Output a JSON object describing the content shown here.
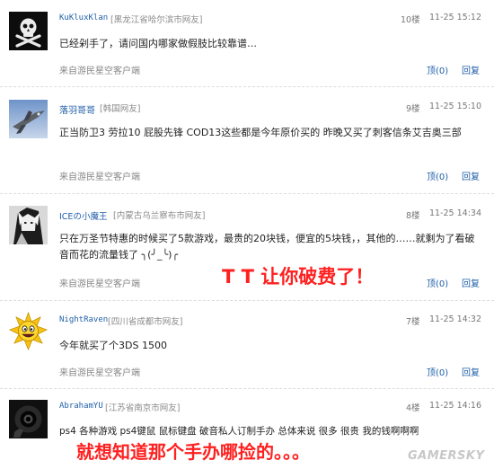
{
  "comments": [
    {
      "user": "KuKluxKlan",
      "location": "[黑龙江省哈尔滨市网友]",
      "floor": "10楼",
      "time": "11-25 15:12",
      "text": "已经剁手了，请问国内哪家做假肢比较靠谱…",
      "source": "来自游民星空客户端",
      "upvote_label": "顶",
      "upvote_count": "(0)",
      "reply_label": "回复",
      "avatar_icon": "skull-crossbones-icon"
    },
    {
      "user": "落羽哥哥",
      "location": "[韩国网友]",
      "floor": "9楼",
      "time": "11-25 15:10",
      "text": "正当防卫3 劳拉10 屁股先锋 COD13这些都是今年原价买的    昨晚又买了刺客信条艾吉奥三部",
      "source": "来自游民星空客户端",
      "upvote_label": "顶",
      "upvote_count": "(0)",
      "reply_label": "回复",
      "avatar_icon": "fighter-jet-icon"
    },
    {
      "user": "ICEの小魔王",
      "location": "[内蒙古乌兰察布市网友]",
      "floor": "8楼",
      "time": "11-25 14:34",
      "text": "只在万圣节特惠的时候买了5款游戏，最贵的20块钱，便宜的5块钱，，其他的……就剩为了看破音而花的流量钱了 ╮(╯_╰)╭",
      "source": "来自游民星空客户端",
      "upvote_label": "顶",
      "upvote_count": "(0)",
      "reply_label": "回复",
      "avatar_icon": "anime-character-icon"
    },
    {
      "user": "NightRaven",
      "location": "[四川省成都市网友]",
      "floor": "7楼",
      "time": "11-25 14:32",
      "text": "今年就买了个3DS 1500",
      "source": "来自游民星空客户端",
      "upvote_label": "顶",
      "upvote_count": "(0)",
      "reply_label": "回复",
      "avatar_icon": "sun-face-icon"
    },
    {
      "user": "AbrahamYU",
      "location": "[江苏省南京市网友]",
      "floor": "4楼",
      "time": "11-25 14:16",
      "text": "ps4 各种游戏 ps4键鼠 鼠标键盘 破音私人订制手办 总体来说 很多 很贵 我的钱啊啊啊",
      "source": "",
      "upvote_label": "",
      "upvote_count": "",
      "reply_label": "",
      "avatar_icon": "revolver-icon"
    }
  ],
  "overlays": {
    "caption_1": "T T 让你破费了！",
    "caption_2": "就想知道那个手办哪捡的。。。"
  },
  "watermark": "GAMERSKY",
  "colors": {
    "link": "#1f5fa8",
    "overlay_red": "#ff2020",
    "meta_gray": "#888888"
  }
}
